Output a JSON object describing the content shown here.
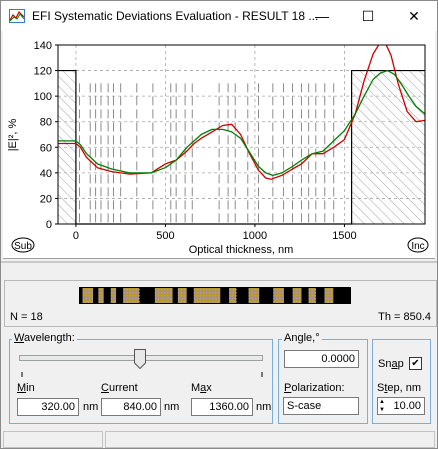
{
  "window": {
    "title": "EFI Systematic Deviations Evaluation - RESULT 18 ...",
    "minimize_glyph": "—",
    "maximize_glyph": "☐",
    "close_glyph": "✕",
    "icon": "app-chart-icon"
  },
  "chart_data": {
    "type": "line",
    "title": "",
    "xlabel": "Optical thickness, nm",
    "ylabel": "|E|², %",
    "xlim": [
      -100,
      1950
    ],
    "ylim": [
      0,
      140
    ],
    "xticks": [
      0,
      500,
      1000,
      1500
    ],
    "yticks": [
      0,
      20,
      40,
      60,
      80,
      100,
      120,
      140
    ],
    "grid": true,
    "substrate_label": "Sub",
    "incidence_label": "Inc",
    "substrate_boundary": 0,
    "incidence_boundary": 1540,
    "medium_level": 120,
    "layer_boundaries": [
      20,
      80,
      110,
      140,
      180,
      210,
      250,
      340,
      430,
      530,
      560,
      610,
      650,
      800,
      850,
      890,
      960,
      1020,
      1100,
      1160,
      1210,
      1260,
      1300,
      1340,
      1390,
      1440
    ],
    "series": [
      {
        "color": "#d00000",
        "x": [
          -100,
          0,
          25,
          60,
          120,
          200,
          300,
          420,
          500,
          560,
          620,
          660,
          700,
          760,
          820,
          870,
          920,
          970,
          1020,
          1060,
          1090,
          1150,
          1210,
          1260,
          1320,
          1380,
          1440,
          1500,
          1560,
          1610,
          1660,
          1700,
          1730,
          1760,
          1800,
          1850,
          1900,
          1950
        ],
        "y": [
          63,
          63,
          60,
          52,
          44,
          41,
          39,
          40,
          47,
          50,
          57,
          63,
          67,
          72,
          77,
          78,
          70,
          55,
          42,
          36,
          35,
          38,
          43,
          47,
          55,
          55,
          60,
          66,
          86,
          112,
          133,
          142,
          141,
          132,
          110,
          88,
          80,
          81
        ]
      },
      {
        "color": "#008000",
        "x": [
          -100,
          0,
          25,
          60,
          120,
          200,
          300,
          420,
          500,
          560,
          620,
          660,
          700,
          760,
          820,
          870,
          920,
          970,
          1020,
          1060,
          1100,
          1150,
          1210,
          1260,
          1320,
          1380,
          1440,
          1500,
          1560,
          1610,
          1660,
          1700,
          1740,
          1780,
          1820,
          1860,
          1900,
          1950
        ],
        "y": [
          65,
          65,
          62,
          55,
          47,
          43,
          40,
          40,
          44,
          50,
          60,
          65,
          70,
          74,
          74,
          72,
          67,
          56,
          45,
          40,
          38,
          40,
          45,
          50,
          55,
          57,
          65,
          73,
          86,
          100,
          113,
          118,
          120,
          117,
          109,
          100,
          92,
          86
        ]
      }
    ]
  },
  "design": {
    "n_label": "N = 18",
    "th_label": "Th = 850.4"
  },
  "wavelength": {
    "group_label": "Wavelength:",
    "slider_value_fraction": 0.5,
    "min_label": "Min",
    "min_value": "320.00",
    "current_label": "Current",
    "current_value": "840.00",
    "max_label": "Max",
    "max_value": "1360.00",
    "unit": "nm"
  },
  "angle": {
    "group_label": "Angle,°",
    "value": "0.0000",
    "polarization_label": "Polarization:",
    "polarization_value": "S-case"
  },
  "snap": {
    "label": "Snap",
    "checked": true,
    "check_glyph": "✔",
    "step_label": "Step, nm",
    "step_value": "10.00",
    "spin_up": "▲",
    "spin_down": "▼"
  }
}
